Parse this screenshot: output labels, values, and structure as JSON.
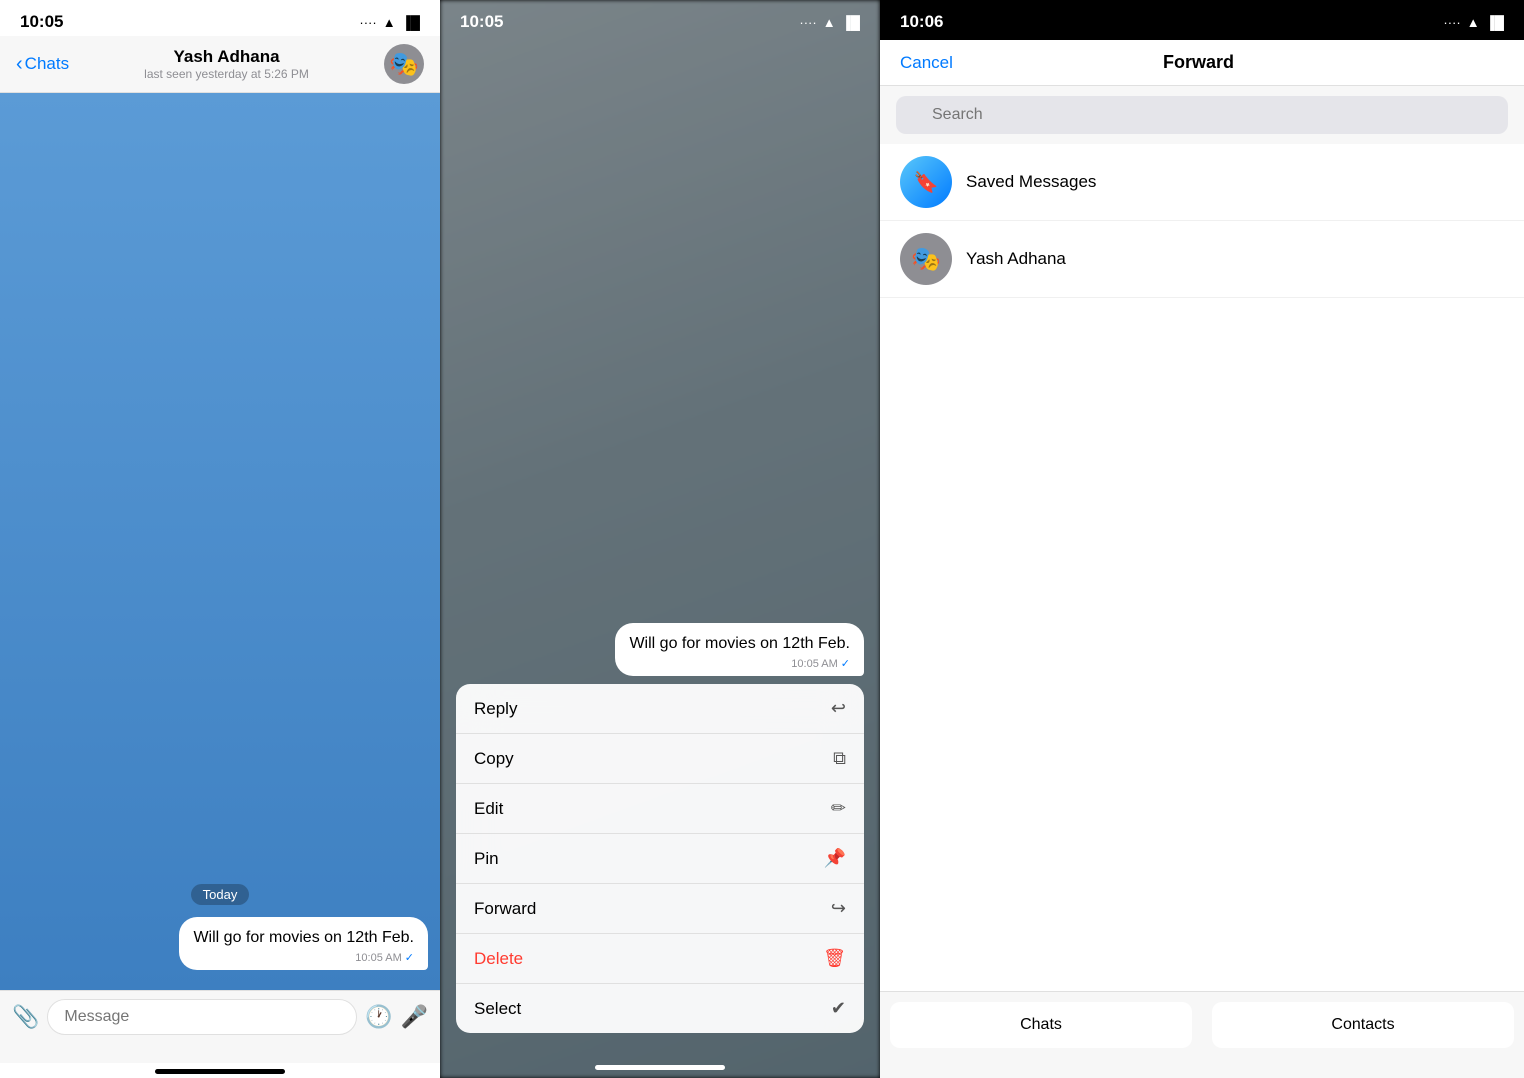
{
  "panel1": {
    "statusTime": "10:05",
    "statusSignal": "····",
    "statusWifi": "WiFi",
    "statusBattery": "🔋",
    "navBack": "Chats",
    "navTitle": "Yash Adhana",
    "navSubtitle": "last seen yesterday at 5:26 PM",
    "dateBadge": "Today",
    "messageText": "Will go for movies on 12th Feb.",
    "messageTime": "10:05 AM",
    "messageCheck": "✓",
    "inputPlaceholder": "Message"
  },
  "panel2": {
    "statusTime": "10:05",
    "messageText": "Will go for movies on 12th Feb.",
    "messageTime": "10:05 AM",
    "messageCheck": "✓",
    "menuItems": [
      {
        "label": "Reply",
        "icon": "↩",
        "red": false
      },
      {
        "label": "Copy",
        "icon": "⧉",
        "red": false
      },
      {
        "label": "Edit",
        "icon": "✏",
        "red": false
      },
      {
        "label": "Pin",
        "icon": "📌",
        "red": false
      },
      {
        "label": "Forward",
        "icon": "↪",
        "red": false
      },
      {
        "label": "Delete",
        "icon": "🗑",
        "red": true
      },
      {
        "label": "Select",
        "icon": "✔",
        "red": false
      }
    ]
  },
  "panel3": {
    "statusTime": "10:06",
    "cancelLabel": "Cancel",
    "forwardTitle": "Forward",
    "searchPlaceholder": "Search",
    "contacts": [
      {
        "name": "Saved Messages",
        "type": "saved"
      },
      {
        "name": "Yash Adhana",
        "type": "person"
      }
    ],
    "tabChats": "Chats",
    "tabContacts": "Contacts"
  }
}
